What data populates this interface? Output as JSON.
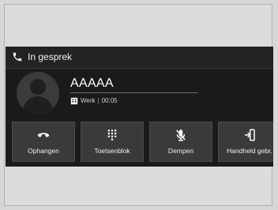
{
  "call_screen": {
    "status": "In gesprek",
    "caller": {
      "name": "AAAAA",
      "type": "Werk",
      "duration": "00:05"
    },
    "buttons": [
      {
        "label": "Ophangen",
        "icon": "hang-up-icon"
      },
      {
        "label": "Toetsenblok",
        "icon": "keypad-icon"
      },
      {
        "label": "Dempen",
        "icon": "mute-icon"
      },
      {
        "label": "Handheld gebr.",
        "icon": "handset-transfer-icon"
      }
    ]
  },
  "colors": {
    "background": "#d7d7d7",
    "screen": "#1b1b1b",
    "button": "#3a3a3a",
    "text": "#ffffff"
  }
}
